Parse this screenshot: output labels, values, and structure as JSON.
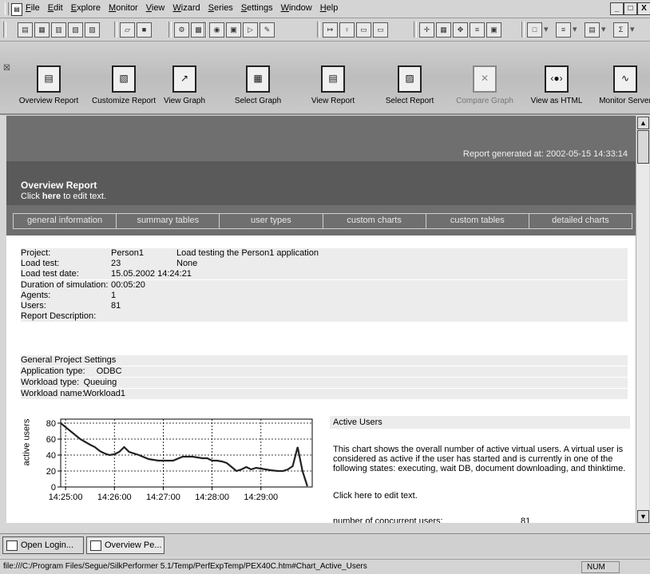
{
  "menu": {
    "items": [
      "File",
      "Edit",
      "Explore",
      "Monitor",
      "View",
      "Wizard",
      "Series",
      "Settings",
      "Window",
      "Help"
    ]
  },
  "window_controls": {
    "minimize": "_",
    "restore": "°",
    "close": "X"
  },
  "toolbar": {
    "buttons": [
      {
        "name": "new-icon",
        "glyph": "▤"
      },
      {
        "name": "report-icon",
        "glyph": "▦"
      },
      {
        "name": "chart-icon",
        "glyph": "▥"
      },
      {
        "name": "compare-icon",
        "glyph": "▧"
      },
      {
        "name": "page-icon",
        "glyph": "▨"
      },
      {
        "name": "open-folder-icon",
        "glyph": "▱"
      },
      {
        "name": "save-icon",
        "glyph": "■"
      },
      {
        "name": "settings-icon",
        "glyph": "⚙"
      },
      {
        "name": "doc-settings-icon",
        "glyph": "▩"
      },
      {
        "name": "record-icon",
        "glyph": "◉"
      },
      {
        "name": "stop-icon",
        "glyph": "▣"
      },
      {
        "name": "play-icon",
        "glyph": "▷"
      },
      {
        "name": "pencil-icon",
        "glyph": "✎"
      },
      {
        "name": "counter-icon",
        "glyph": "↦"
      },
      {
        "name": "bulb-icon",
        "glyph": "♀"
      },
      {
        "name": "graph-window-icon",
        "glyph": "▭"
      },
      {
        "name": "graph-window2-icon",
        "glyph": "▭"
      },
      {
        "name": "crosshair-icon",
        "glyph": "✛"
      },
      {
        "name": "grid-icon",
        "glyph": "▦"
      },
      {
        "name": "move-icon",
        "glyph": "✥"
      },
      {
        "name": "align-icon",
        "glyph": "≡"
      },
      {
        "name": "export-icon",
        "glyph": "▣"
      },
      {
        "name": "color-box-icon",
        "glyph": "□"
      },
      {
        "name": "line-style-icon",
        "glyph": "≡"
      },
      {
        "name": "table-icon",
        "glyph": "▤"
      },
      {
        "name": "sum-icon",
        "glyph": "Σ"
      }
    ]
  },
  "big_toolbar": {
    "buttons": [
      {
        "label": "Overview Report",
        "icon": "overview-report-icon",
        "glyph": "▤",
        "disabled": false
      },
      {
        "label": "Customize Report",
        "icon": "customize-report-icon",
        "glyph": "▧",
        "disabled": false
      },
      {
        "label": "View Graph",
        "icon": "view-graph-icon",
        "glyph": "↗",
        "disabled": false
      },
      {
        "label": "Select Graph",
        "icon": "select-graph-icon",
        "glyph": "▦",
        "disabled": false
      },
      {
        "label": "View Report",
        "icon": "view-report-icon",
        "glyph": "▤",
        "disabled": false
      },
      {
        "label": "Select Report",
        "icon": "select-report-icon",
        "glyph": "▨",
        "disabled": false
      },
      {
        "label": "Compare Graph",
        "icon": "compare-graph-icon",
        "glyph": "✕",
        "disabled": true
      },
      {
        "label": "View as HTML",
        "icon": "view-html-icon",
        "glyph": "‹●›",
        "disabled": false
      },
      {
        "label": "Monitor Server",
        "icon": "monitor-server-icon",
        "glyph": "∿",
        "disabled": false
      }
    ]
  },
  "report": {
    "generated": "Report generated at: 2002-05-15 14:33:14",
    "title": "Overview Report",
    "sub_prefix": "Click ",
    "sub_link": "here",
    "sub_suffix": " to edit text.",
    "tabs": [
      "general information",
      "summary tables",
      "user types",
      "custom charts",
      "custom tables",
      "detailed charts"
    ],
    "info": [
      {
        "key": "Project:",
        "value": "Person1",
        "extra": "Load testing the Person1 application"
      },
      {
        "key": "Load test:",
        "value": "23",
        "extra": "None"
      },
      {
        "key": "Load test date:",
        "value": "15.05.2002 14:24:21",
        "extra": ""
      },
      {
        "key": "Duration of simulation:",
        "value": "00:05:20",
        "extra": ""
      },
      {
        "key": "Agents:",
        "value": "1",
        "extra": ""
      },
      {
        "key": "Users:",
        "value": "81",
        "extra": ""
      },
      {
        "key": "Report Description:",
        "value": "",
        "extra": ""
      }
    ],
    "settings_title": "General Project Settings",
    "settings": [
      {
        "key": "Application type:",
        "value": "ODBC"
      },
      {
        "key": "Workload type:",
        "value": "Queuing"
      },
      {
        "key": "Workload name:",
        "value": "Workload1"
      }
    ],
    "chart_desc": {
      "title": "Active Users",
      "body": "This chart shows the overall number of active virtual users. A virtual user is considered as active if the user has started and is currently in one of the following states: executing, wait DB, document downloading, and thinktime.",
      "edit": "Click here to edit text.",
      "concurrent_label": "number of concurrent users:",
      "concurrent_value": "81"
    }
  },
  "chart_data": {
    "type": "line",
    "title": "",
    "xlabel": "",
    "ylabel": "active users",
    "x_ticks": [
      "14:25:00",
      "14:26:00",
      "14:27:00",
      "14:28:00",
      "14:29:00"
    ],
    "y_ticks": [
      0,
      20,
      40,
      60,
      80
    ],
    "ylim": [
      0,
      85
    ],
    "xlim_minutes": [
      -0.1,
      5.05
    ],
    "grid": true,
    "series": [
      {
        "x": [
          -0.1,
          0.1,
          0.3,
          0.5,
          0.6,
          0.7,
          0.8,
          0.9,
          1.0,
          1.1,
          1.2,
          1.3,
          1.5,
          1.7,
          1.9,
          2.0,
          2.2,
          2.4,
          2.6,
          2.8,
          2.9,
          3.0,
          3.1,
          3.2,
          3.3,
          3.4,
          3.5,
          3.6,
          3.7,
          3.8,
          3.9,
          4.0,
          4.1,
          4.2,
          4.35,
          4.45,
          4.55,
          4.65,
          4.75,
          4.85,
          4.95
        ],
        "y": [
          80,
          70,
          60,
          53,
          50,
          45,
          42,
          40,
          41,
          44,
          50,
          44,
          40,
          35,
          33,
          33,
          33,
          38,
          38,
          36,
          36,
          33,
          33,
          32,
          30,
          25,
          20,
          22,
          25,
          22,
          24,
          23,
          22,
          21,
          20,
          20,
          22,
          26,
          50,
          20,
          1
        ]
      }
    ]
  },
  "taskbar": {
    "items": [
      {
        "label": "Open Login...",
        "icon": "open-login-icon"
      },
      {
        "label": "Overview Pe...",
        "icon": "overview-page-icon"
      }
    ]
  },
  "status": {
    "path": "file:///C:/Program Files/Segue/SilkPerformer 5.1/Temp/PerfExpTemp/PEX40C.htm#Chart_Active_Users",
    "num": "NUM"
  }
}
